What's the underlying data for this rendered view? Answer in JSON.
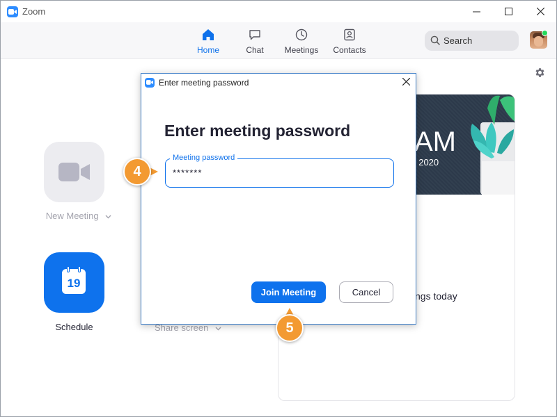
{
  "window": {
    "title": "Zoom"
  },
  "nav": {
    "items": [
      {
        "label": "Home",
        "icon": "home-icon",
        "active": true
      },
      {
        "label": "Chat",
        "icon": "chat-icon"
      },
      {
        "label": "Meetings",
        "icon": "clock-icon"
      },
      {
        "label": "Contacts",
        "icon": "contacts-icon"
      }
    ],
    "search_label": "Search"
  },
  "home": {
    "new_meeting_label": "New Meeting",
    "schedule_label": "Schedule",
    "schedule_day": "19",
    "share_screen_label": "Share screen"
  },
  "card": {
    "clock_text": "AM",
    "date_text": ", 2020",
    "no_meetings_text": "ngs today"
  },
  "dialog": {
    "title": "Enter meeting password",
    "heading": "Enter meeting password",
    "field_label": "Meeting password",
    "field_value": "*******",
    "join_label": "Join Meeting",
    "cancel_label": "Cancel"
  },
  "callouts": {
    "step4": "4",
    "step5": "5"
  },
  "colors": {
    "accent": "#0e72ed",
    "callout": "#f39a32",
    "status_online": "#23d959"
  }
}
